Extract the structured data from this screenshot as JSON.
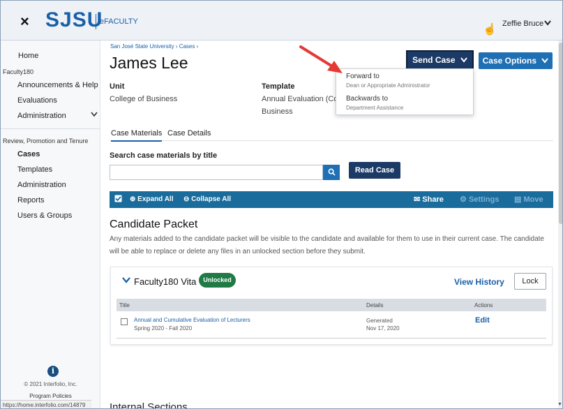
{
  "header": {
    "close_icon": "×",
    "logo": "SJSU",
    "app_name": "eFACULTY",
    "user_name": "Zeffie Bruce",
    "caret": "⌄"
  },
  "sidebar": {
    "home": "Home",
    "faculty_group": "Faculty180",
    "faculty_items": [
      "Announcements & Help",
      "Evaluations",
      "Administration"
    ],
    "rpt_group": "Review, Promotion and Tenure",
    "rpt_items": [
      "Cases",
      "Templates",
      "Administration",
      "Reports",
      "Users & Groups"
    ],
    "copyright": "© 2021 Interfolio, Inc.",
    "policies": "Program Policies",
    "status_url": "https://home.interfolio.com/14879"
  },
  "main": {
    "breadcrumb": "San José State University  ›  Cases  ›",
    "title": "James Lee",
    "unit_label": "Unit",
    "unit_value": "College of Business",
    "template_label": "Template",
    "template_value_1": "Annual Evaluation (Com",
    "template_value_2": "Business",
    "send_case": "Send Case",
    "case_options": "Case Options",
    "dropdown": {
      "forward_title": "Forward to",
      "forward_sub": "Dean or Appropriate Administrator",
      "backward_title": "Backwards to",
      "backward_sub": "Department Assistance"
    },
    "tabs": [
      "Case Materials",
      "Case Details"
    ],
    "search_label": "Search case materials by title",
    "search_placeholder": "",
    "read_case": "Read Case",
    "toolbar": {
      "expand_all": "Expand All",
      "collapse_all": "Collapse All",
      "share": "Share",
      "settings": "Settings",
      "move": "Move"
    },
    "packet_title": "Candidate Packet",
    "packet_desc": "Any materials added to the candidate packet will be visible to the candidate and available for them to use in their current case. The candidate will be able to replace or delete any files in an unlocked section before they submit.",
    "section": {
      "name": "Faculty180 Vita",
      "badge": "Unlocked",
      "view_history": "View History",
      "lock": "Lock",
      "columns": [
        "Title",
        "Details",
        "Actions"
      ],
      "rows": [
        {
          "title": "Annual and Cumulative Evaluation of Lecturers",
          "subtitle": "Spring 2020 - Fall 2020",
          "details_1": "Generated",
          "details_2": "Nov 17, 2020",
          "action": "Edit"
        }
      ]
    },
    "internal_sections": "Internal Sections"
  },
  "colors": {
    "brand_blue": "#1a5fa8",
    "navy": "#1c3a66",
    "toolbar": "#1a6c9d",
    "unlocked_green": "#1f7a45",
    "arrow_red": "#e53935"
  }
}
